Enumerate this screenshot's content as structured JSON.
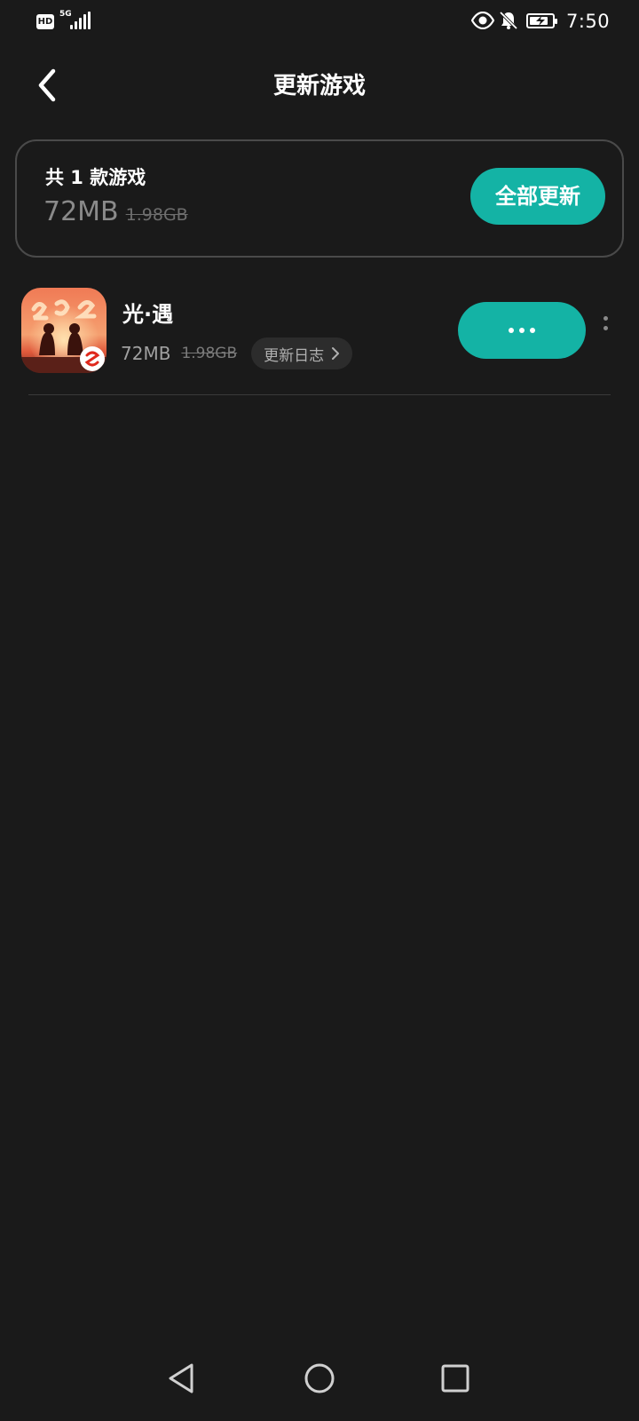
{
  "status_bar": {
    "hd_label": "HD",
    "network_label": "5G",
    "time": "7:50",
    "icons": [
      "signal-icon",
      "eye-icon",
      "bell-off-icon",
      "battery-charging-icon"
    ]
  },
  "header": {
    "title": "更新游戏",
    "back_icon": "chevron-left-icon"
  },
  "summary": {
    "count_text": "共 1 款游戏",
    "new_size": "72MB",
    "old_size": "1.98GB",
    "update_all_label": "全部更新"
  },
  "games": [
    {
      "name": "光·遇",
      "new_size": "72MB",
      "old_size": "1.98GB",
      "changelog_label": "更新日志",
      "action_state": "loading"
    }
  ],
  "nav_bar": {
    "icons": [
      "nav-back-icon",
      "nav-home-icon",
      "nav-recent-icon"
    ]
  },
  "colors": {
    "background": "#1a1a1a",
    "accent": "#14b3a5",
    "card_border": "#4a4a4a",
    "muted_text": "#8a8a8a"
  }
}
